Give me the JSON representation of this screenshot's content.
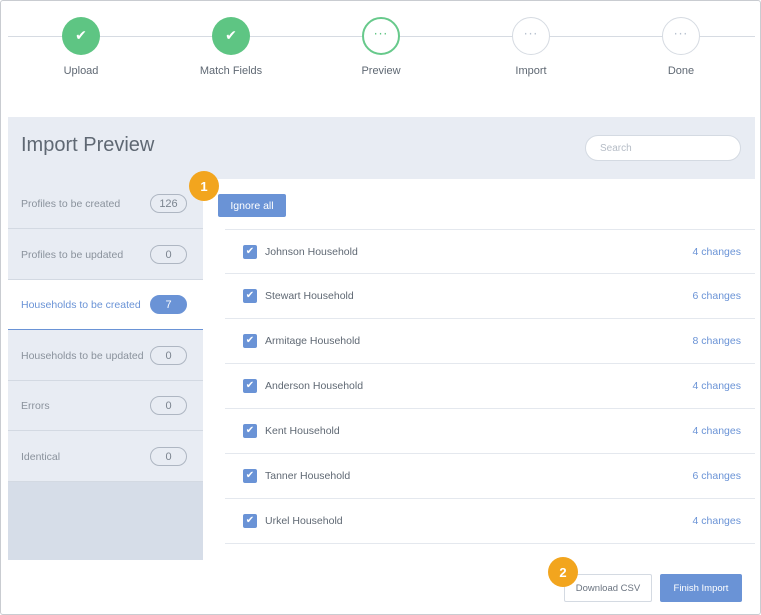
{
  "stepper": {
    "steps": [
      {
        "label": "Upload",
        "status": "done"
      },
      {
        "label": "Match Fields",
        "status": "done"
      },
      {
        "label": "Preview",
        "status": "current"
      },
      {
        "label": "Import",
        "status": "pending"
      },
      {
        "label": "Done",
        "status": "pending"
      }
    ],
    "done_glyph": "✔",
    "pending_glyph": "···"
  },
  "header": {
    "title": "Import Preview",
    "search_placeholder": "Search"
  },
  "sidebar": {
    "items": [
      {
        "label": "Profiles to be created",
        "count": "126",
        "active": false
      },
      {
        "label": "Profiles to be updated",
        "count": "0",
        "active": false
      },
      {
        "label": "Households to be created",
        "count": "7",
        "active": true
      },
      {
        "label": "Households to be updated",
        "count": "0",
        "active": false
      },
      {
        "label": "Errors",
        "count": "0",
        "active": false
      },
      {
        "label": "Identical",
        "count": "0",
        "active": false
      }
    ]
  },
  "main": {
    "ignore_all_label": "Ignore all",
    "check_glyph": "✔",
    "rows": [
      {
        "name": "Johnson Household",
        "changes": "4 changes",
        "checked": true
      },
      {
        "name": "Stewart Household",
        "changes": "6 changes",
        "checked": true
      },
      {
        "name": "Armitage Household",
        "changes": "8 changes",
        "checked": true
      },
      {
        "name": "Anderson Household",
        "changes": "4 changes",
        "checked": true
      },
      {
        "name": "Kent Household",
        "changes": "4 changes",
        "checked": true
      },
      {
        "name": "Tanner Household",
        "changes": "6 changes",
        "checked": true
      },
      {
        "name": "Urkel Household",
        "changes": "4 changes",
        "checked": true
      }
    ]
  },
  "footer": {
    "download_csv_label": "Download CSV",
    "finish_import_label": "Finish Import"
  },
  "callouts": {
    "one": "1",
    "two": "2"
  },
  "colors": {
    "accent": "#6a93d6",
    "success": "#5ec583",
    "callout": "#f2a51e",
    "panel": "#e8ecf3"
  }
}
